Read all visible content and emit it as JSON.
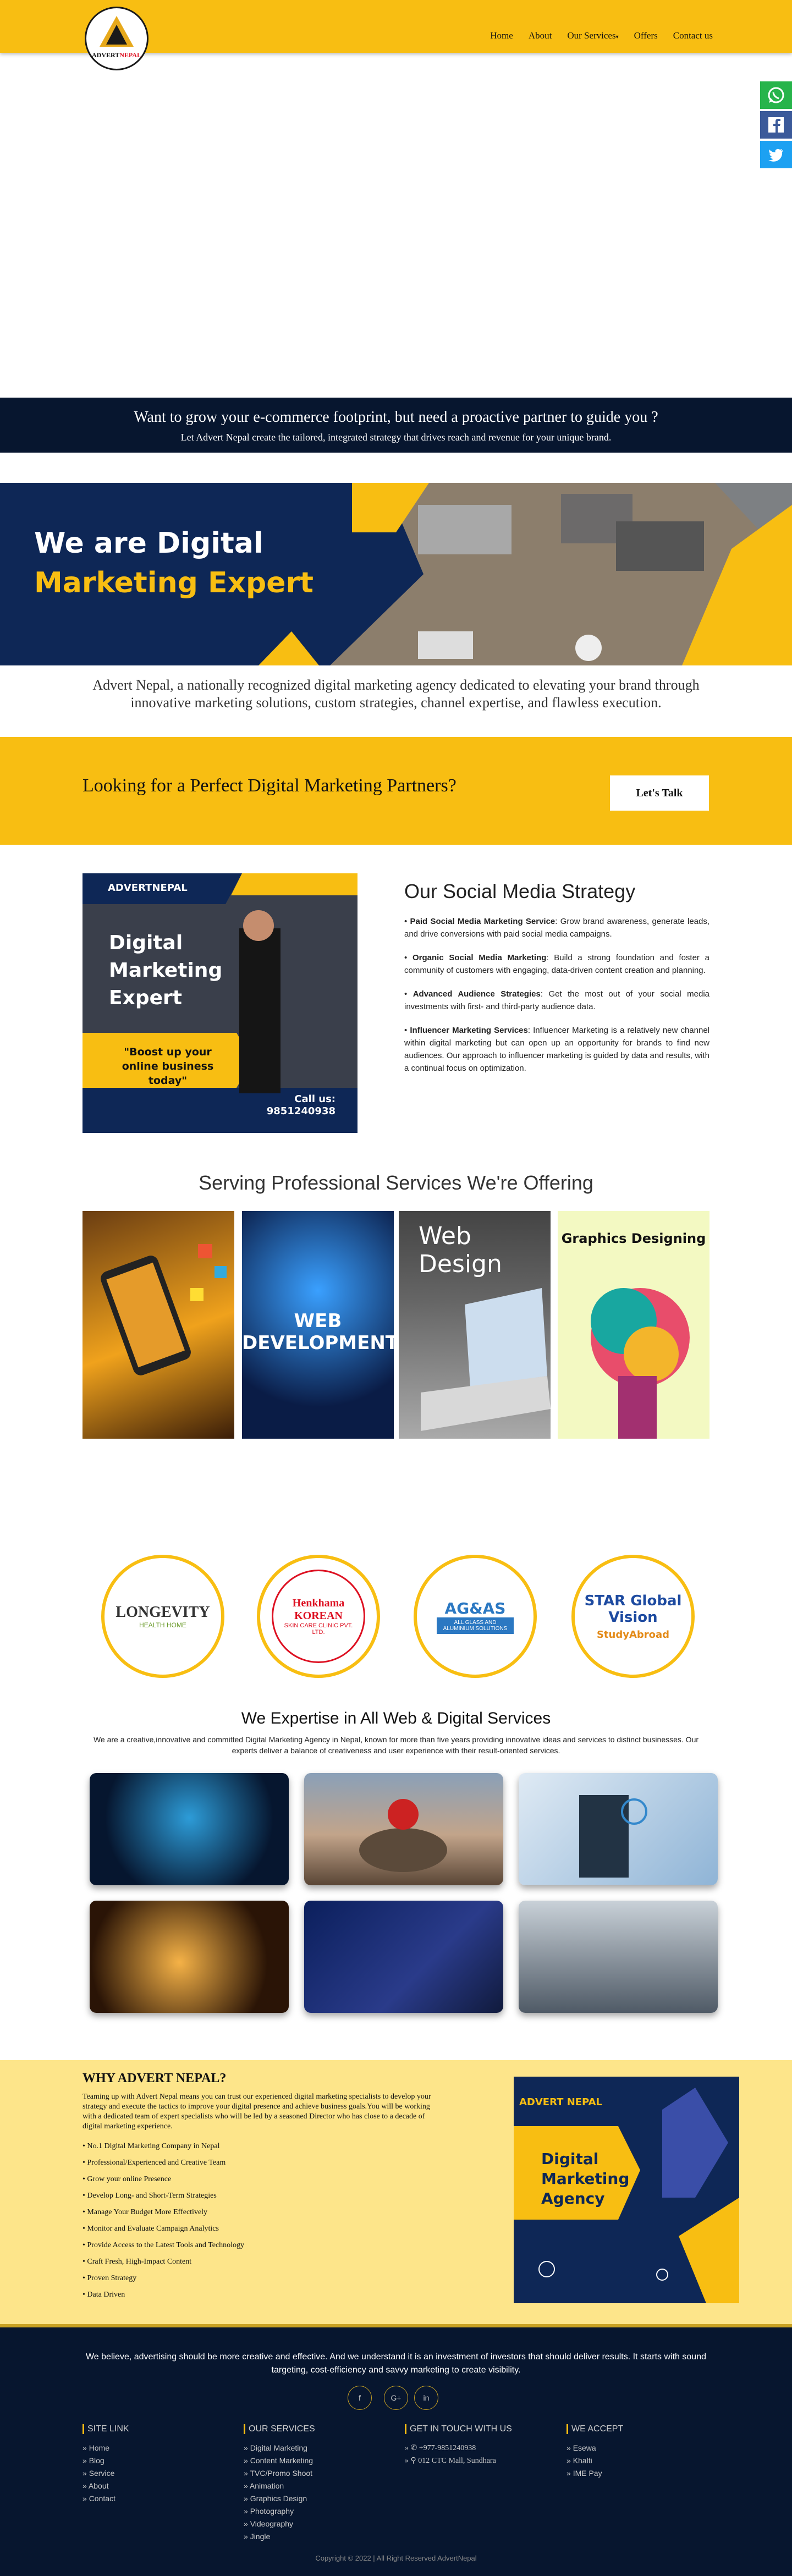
{
  "brand": {
    "logo_text_1": "ADVERT",
    "logo_text_2": "NEPAL"
  },
  "nav": {
    "items": [
      "Home",
      "About",
      "Our Services",
      "Offers",
      "Contact us"
    ]
  },
  "banner": {
    "title": "Want to grow your e-commerce footprint, but need a proactive partner to guide you ?",
    "subtitle": "Let Advert Nepal create the tailored, integrated strategy that drives reach and revenue for your unique brand."
  },
  "hero": {
    "line1": "We are Digital",
    "line2": "Marketing Expert"
  },
  "intro": "Advert Nepal, a nationally recognized digital marketing agency dedicated to elevating your brand through innovative marketing solutions, custom strategies, channel expertise, and flawless execution.",
  "cta": {
    "title": "Looking for a Perfect Digital Marketing Partners?",
    "button": "Let's Talk"
  },
  "promo": {
    "brand": "ADVERTNEPAL",
    "line1": "Digital",
    "line2": "Marketing",
    "line3": "Expert",
    "quote1": "\"Boost up your",
    "quote2": "online business today\"",
    "call": "Call us:",
    "phone": "9851240938"
  },
  "strategy": {
    "title": "Our Social Media Strategy",
    "items": [
      {
        "label": "Paid Social Media Marketing Service",
        "text": ": Grow brand awareness, generate leads, and drive conversions with paid social media campaigns."
      },
      {
        "label": "Organic Social Media Marketing",
        "text": ": Build a strong foundation and foster a community of customers with engaging, data-driven content creation and planning."
      },
      {
        "label": "Advanced Audience Strategies",
        "text": ": Get the most out of your social media investments with first- and third-party audience data."
      },
      {
        "label": "Influencer Marketing Services",
        "text": ": Influencer Marketing is a relatively new channel within digital marketing but can open up an opportunity for brands to find new audiences. Our approach to influencer marketing is guided by data and results, with a continual focus on optimization."
      }
    ]
  },
  "services": {
    "title": "Serving Professional Services We're Offering",
    "cards": [
      "",
      "WEB DEVELOPMENT",
      "Web Design",
      "Graphics Designing"
    ]
  },
  "clients": [
    {
      "name": "LONGEVITY",
      "sub": "HEALTH HOME"
    },
    {
      "name": "Henkhama KOREAN",
      "sub": "SKIN CARE CLINIC PVT. LTD."
    },
    {
      "name": "AG&AS",
      "sub": "ALL GLASS AND ALUMINIUM SOLUTIONS"
    },
    {
      "name": "STAR Global Vision",
      "sub": "StudyAbroad"
    }
  ],
  "expertise": {
    "title": "We Expertise in All Web & Digital Services",
    "desc": "We are a creative,innovative and committed Digital Marketing Agency in Nepal, known for more than five years providing innovative ideas and services to distinct businesses. Our experts deliver a balance of creativeness and user experience with their result-oriented services."
  },
  "why": {
    "title": "WHY ADVERT NEPAL?",
    "desc": "Teaming up with Advert Nepal means you can trust our experienced digital marketing specialists to develop your strategy and execute the tactics to improve your digital presence and achieve business goals.You will be working with a dedicated team of expert specialists who will be led by a seasoned Director who has close to a decade of digital marketing experience.",
    "items": [
      "No.1 Digital Marketing Company in Nepal",
      "Professional/Experienced and Creative Team",
      "Grow your online Presence",
      "Develop Long- and Short-Term Strategies",
      "Manage Your Budget More Effectively",
      "Monitor and Evaluate Campaign Analytics",
      "Provide Access to the Latest Tools and Technology",
      "Craft Fresh, High-Impact Content",
      "Proven Strategy",
      "Data Driven"
    ],
    "img_brand": "ADVERT NEPAL",
    "img_line1": "Digital",
    "img_line2": "Marketing",
    "img_line3": "Agency"
  },
  "footer": {
    "text": "We believe, advertising should be more creative and effective. And we understand it is an investment of investors that should deliver results. It starts with sound targeting, cost-efficiency and savvy marketing to create visibility.",
    "social": [
      "f",
      "G+",
      "in"
    ],
    "site_link_title": "SITE LINK",
    "site_links": [
      "Home",
      "Blog",
      "Service",
      "About",
      "Contact"
    ],
    "services_title": "OUR SERVICES",
    "services": [
      "Digital Marketing",
      "Content Marketing",
      "TVC/Promo Shoot",
      "Animation",
      "Graphics Design",
      "Photography",
      "Videography",
      "Jingle"
    ],
    "contact_title": "GET IN TOUCH WITH US",
    "phone": "+977-9851240938",
    "address": "012 CTC Mall, Sundhara",
    "accept_title": "WE ACCEPT",
    "accept": [
      "Esewa",
      "Khalti",
      "IME Pay"
    ],
    "copyright": "Copyright © 2022 | All Right Reserved AdvertNepal"
  }
}
